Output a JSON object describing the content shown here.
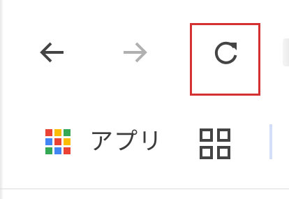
{
  "toolbar": {
    "back_icon": "arrow-left-icon",
    "forward_icon": "arrow-right-icon",
    "reload_icon": "reload-icon"
  },
  "bookmarks_bar": {
    "apps_label": "アプリ",
    "apps_icon": "apps-grid-icon",
    "apps_colors": [
      "#ea4335",
      "#fbbc05",
      "#34a853",
      "#4285f4",
      "#ea4335",
      "#fbbc05",
      "#34a853",
      "#4285f4",
      "#ea4335"
    ],
    "reading_list_icon": "grid-four-squares-icon"
  },
  "colors": {
    "icon_dark": "#444444",
    "icon_disabled": "#b0b0b0",
    "highlight": "#d43232"
  }
}
